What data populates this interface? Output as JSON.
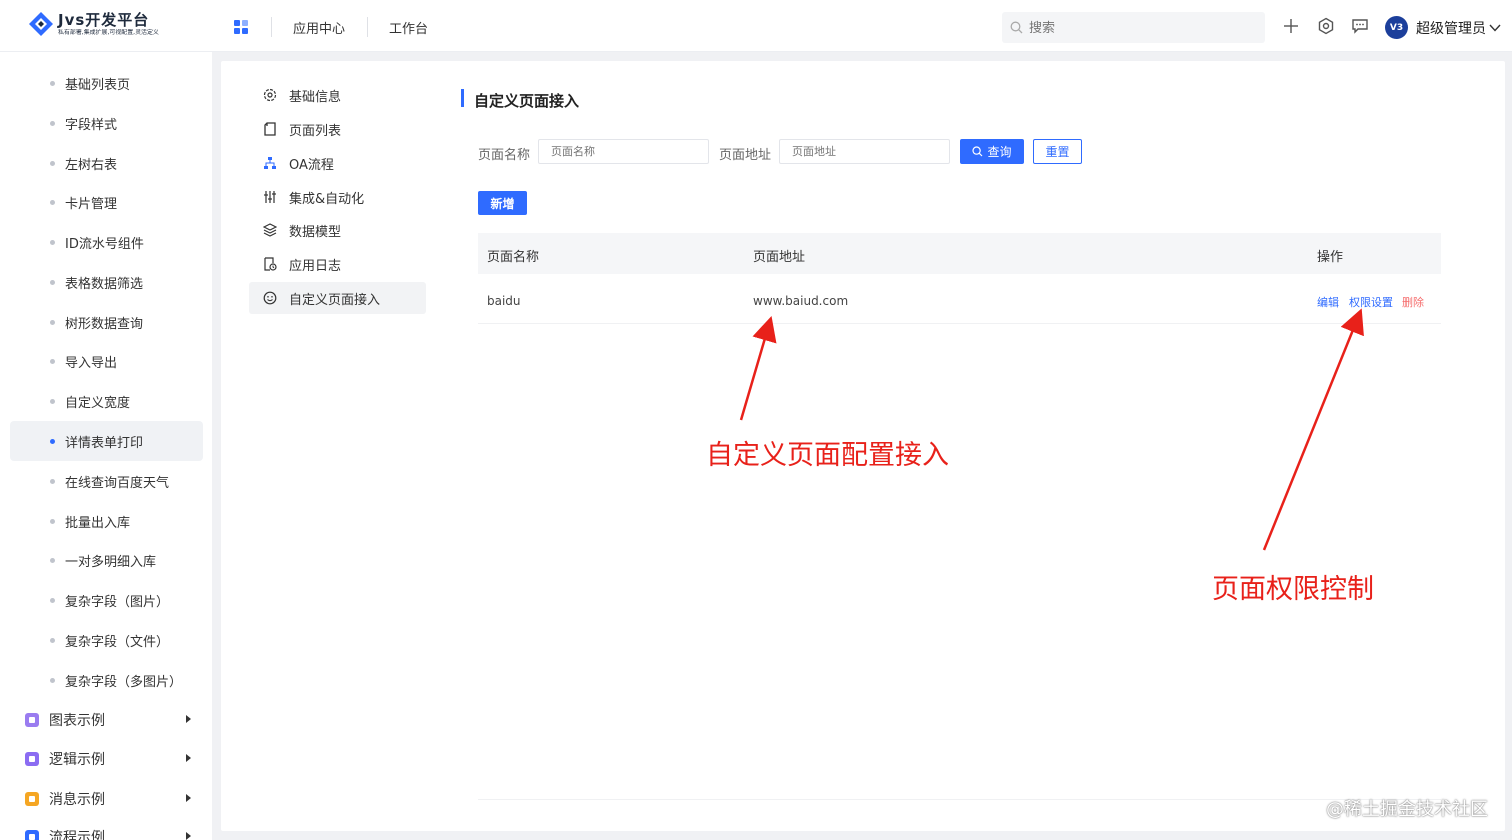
{
  "header": {
    "logo_title": "Jvs开发平台",
    "logo_subtitle": "私有部署,集成扩展,可视配置,灵活定义",
    "nav": [
      "应用中心",
      "工作台"
    ],
    "search_placeholder": "搜索",
    "avatar_text": "V3",
    "username": "超级管理员"
  },
  "sidebar": {
    "items": [
      {
        "label": "基础列表页",
        "active": false
      },
      {
        "label": "字段样式",
        "active": false
      },
      {
        "label": "左树右表",
        "active": false
      },
      {
        "label": "卡片管理",
        "active": false
      },
      {
        "label": "ID流水号组件",
        "active": false
      },
      {
        "label": "表格数据筛选",
        "active": false
      },
      {
        "label": "树形数据查询",
        "active": false
      },
      {
        "label": "导入导出",
        "active": false
      },
      {
        "label": "自定义宽度",
        "active": false
      },
      {
        "label": "详情表单打印",
        "active": true
      },
      {
        "label": "在线查询百度天气",
        "active": false
      },
      {
        "label": "批量出入库",
        "active": false
      },
      {
        "label": "一对多明细入库",
        "active": false
      },
      {
        "label": "复杂字段（图片）",
        "active": false
      },
      {
        "label": "复杂字段（文件）",
        "active": false
      },
      {
        "label": "复杂字段（多图片）",
        "active": false
      }
    ],
    "groups": [
      {
        "label": "图表示例",
        "color": "#9a7cf0"
      },
      {
        "label": "逻辑示例",
        "color": "#8b6cf2"
      },
      {
        "label": "消息示例",
        "color": "#f5a623"
      },
      {
        "label": "流程示例",
        "color": "#2f6bff"
      }
    ]
  },
  "submenu": [
    {
      "label": "基础信息",
      "icon": "gear-icon"
    },
    {
      "label": "页面列表",
      "icon": "page-icon"
    },
    {
      "label": "OA流程",
      "icon": "flow-icon"
    },
    {
      "label": "集成&自动化",
      "icon": "sliders-icon"
    },
    {
      "label": "数据模型",
      "icon": "layers-icon"
    },
    {
      "label": "应用日志",
      "icon": "log-icon"
    },
    {
      "label": "自定义页面接入",
      "icon": "smile-icon"
    }
  ],
  "content": {
    "title": "自定义页面接入",
    "filters": {
      "name_label": "页面名称",
      "name_placeholder": "页面名称",
      "url_label": "页面地址",
      "url_placeholder": "页面地址",
      "query_button": "查询",
      "reset_button": "重置"
    },
    "add_button": "新增",
    "table": {
      "columns": [
        "页面名称",
        "页面地址",
        "操作"
      ],
      "rows": [
        {
          "name": "baidu",
          "url": "www.baiud.com",
          "actions": [
            "编辑",
            "权限设置",
            "删除"
          ]
        }
      ]
    }
  },
  "annotations": {
    "left": "自定义页面配置接入",
    "right": "页面权限控制",
    "color": "#e8211a"
  },
  "footer_watermark": "@稀土掘金技术社区",
  "colors": {
    "primary": "#2f6bff",
    "danger": "#f56c6c"
  }
}
